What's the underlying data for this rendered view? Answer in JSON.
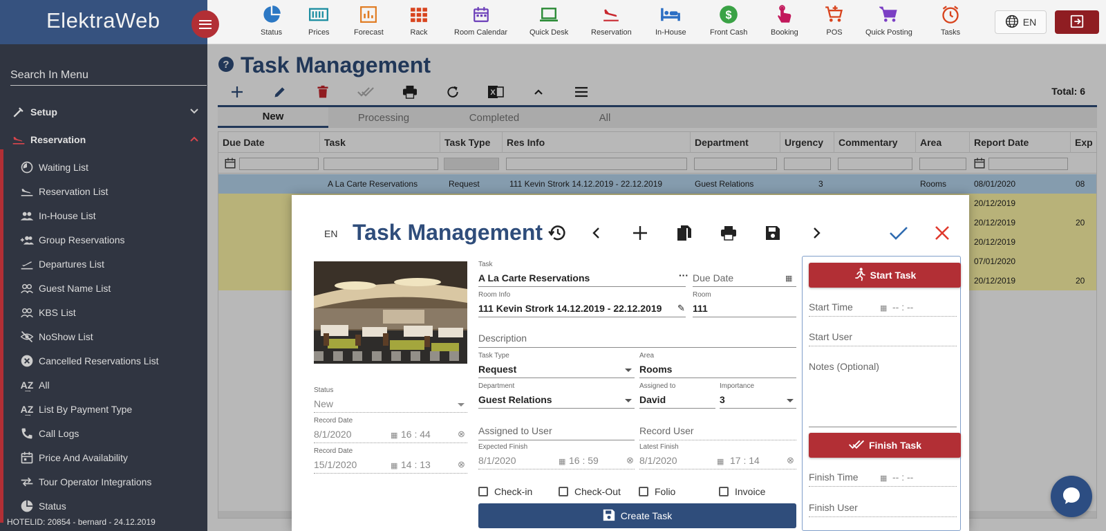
{
  "app": {
    "brand": "ElektraWeb",
    "hotel_line": "HOTELID: 20854 - bernard - 24.12.2019"
  },
  "sidebar": {
    "search_placeholder": "Search In Menu",
    "groups": [
      {
        "label": "Setup",
        "icon": "wrench-icon",
        "expanded": false
      },
      {
        "label": "Reservation",
        "icon": "airplane-landing-icon",
        "expanded": true
      }
    ],
    "items": [
      {
        "label": "Waiting List",
        "icon": "timer-icon"
      },
      {
        "label": "Reservation List",
        "icon": "airplane-landing-icon"
      },
      {
        "label": "In-House List",
        "icon": "people-icon"
      },
      {
        "label": "Group Reservations",
        "icon": "group-add-icon"
      },
      {
        "label": "Departures List",
        "icon": "airplane-takeoff-icon"
      },
      {
        "label": "Guest Name List",
        "icon": "people-outline-icon"
      },
      {
        "label": "KBS List",
        "icon": "people-outline-icon"
      },
      {
        "label": "NoShow List",
        "icon": "eye-off-icon"
      },
      {
        "label": "Cancelled Reservations List",
        "icon": "cancel-icon"
      },
      {
        "label": "All",
        "icon": "sort-az-icon"
      },
      {
        "label": "List By Payment Type",
        "icon": "sort-az-icon"
      },
      {
        "label": "Call Logs",
        "icon": "phone-icon"
      },
      {
        "label": "Price And Availability",
        "icon": "calendar-icon"
      },
      {
        "label": "Tour Operator Integrations",
        "icon": "swap-icon"
      },
      {
        "label": "Status",
        "icon": "pie-icon"
      }
    ]
  },
  "toolbar": {
    "items": [
      {
        "label": "Status",
        "icon": "pie-chart-icon",
        "color": "#2c78c4"
      },
      {
        "label": "Prices",
        "icon": "prices-icon",
        "color": "#1f8fa2"
      },
      {
        "label": "Forecast",
        "icon": "forecast-icon",
        "color": "#e07a1f"
      },
      {
        "label": "Rack",
        "icon": "rack-icon",
        "color": "#d8441e"
      },
      {
        "label": "Room Calendar",
        "icon": "calendar-icon",
        "color": "#6a3db8"
      },
      {
        "label": "Quick Desk",
        "icon": "laptop-icon",
        "color": "#2a8a35"
      },
      {
        "label": "Reservation",
        "icon": "airplane-landing-icon",
        "color": "#c8282f"
      },
      {
        "label": "In-House",
        "icon": "bed-icon",
        "color": "#2c6fc4"
      },
      {
        "label": "Front Cash",
        "icon": "dollar-icon",
        "color": "#3aa245"
      },
      {
        "label": "Booking",
        "icon": "touch-icon",
        "color": "#c2185b"
      },
      {
        "label": "POS",
        "icon": "cart-plus-icon",
        "color": "#d8441e"
      },
      {
        "label": "Quick Posting",
        "icon": "cart-icon",
        "color": "#7b3fc4"
      },
      {
        "label": "Tasks",
        "icon": "alarm-icon",
        "color": "#d8441e"
      }
    ],
    "language": "EN"
  },
  "page": {
    "title": "Task Management",
    "total": "Total: 6",
    "tabs": [
      "New",
      "Processing",
      "Completed",
      "All"
    ],
    "active_tab": "New",
    "columns": [
      "Due Date",
      "Task",
      "Task Type",
      "Res Info",
      "Department",
      "Urgency",
      "Commentary",
      "Area",
      "Report Date",
      "Exp"
    ],
    "rows": [
      {
        "task": "A La Carte Reservations",
        "type": "Request",
        "resinfo": "111 Kevin Strork 14.12.2019 - 22.12.2019",
        "department": "Guest Relations",
        "urgency": "3",
        "area": "Rooms",
        "report": "08/01/2020",
        "exp": "08"
      },
      {
        "report": "20/12/2019",
        "exp": ""
      },
      {
        "report": "20/12/2019",
        "exp": "20"
      },
      {
        "report": "20/12/2019",
        "exp": ""
      },
      {
        "report": "07/01/2020",
        "exp": ""
      },
      {
        "report": "20/12/2019",
        "exp": "20"
      }
    ]
  },
  "modal": {
    "lang": "EN",
    "title": "Task Management",
    "status": {
      "label": "Status",
      "value": "New"
    },
    "record_date_1": {
      "label": "Record Date",
      "date": "8/1/2020",
      "time": "16 : 44"
    },
    "record_date_2": {
      "label": "Record Date",
      "date": "15/1/2020",
      "time": "14 : 13"
    },
    "task": {
      "label": "Task",
      "value": "A La Carte Reservations"
    },
    "due_date": {
      "placeholder": "Due Date"
    },
    "room_info": {
      "label": "Room Info",
      "value": "111 Kevin Strork 14.12.2019 - 22.12.2019"
    },
    "room": {
      "label": "Room",
      "value": "111"
    },
    "description": {
      "placeholder": "Description"
    },
    "task_type": {
      "label": "Task Type",
      "value": "Request"
    },
    "area": {
      "label": "Area",
      "value": "Rooms"
    },
    "department": {
      "label": "Department",
      "value": "Guest Relations"
    },
    "assigned_to": {
      "label": "Assigned to",
      "value": "David"
    },
    "importance": {
      "label": "Importance",
      "value": "3"
    },
    "assigned_to_user": {
      "placeholder": "Assigned to User"
    },
    "record_user": {
      "placeholder": "Record User"
    },
    "expected_finish": {
      "label": "Expected Finish",
      "date": "8/1/2020",
      "time": "16 : 59"
    },
    "latest_finish": {
      "label": "Latest Finish",
      "date": "8/1/2020",
      "time": "17 : 14"
    },
    "checkboxes": [
      "Check-in",
      "Check-Out",
      "Folio",
      "Invoice"
    ],
    "create_button": "Create Task",
    "start_button": "Start Task",
    "start_time": {
      "placeholder": "Start Time",
      "time": "-- : --"
    },
    "start_user": {
      "placeholder": "Start User"
    },
    "notes": {
      "placeholder": "Notes (Optional)"
    },
    "finish_button": "Finish Task",
    "finish_time": {
      "placeholder": "Finish Time",
      "time": "-- : --"
    },
    "finish_user": {
      "placeholder": "Finish User"
    }
  },
  "colors": {
    "primary": "#2f4d7b",
    "accent_red": "#b22f35",
    "sidebar_bg": "#303541",
    "selected_row": "#b9d8f2",
    "highlight_row": "#fff7a8"
  }
}
